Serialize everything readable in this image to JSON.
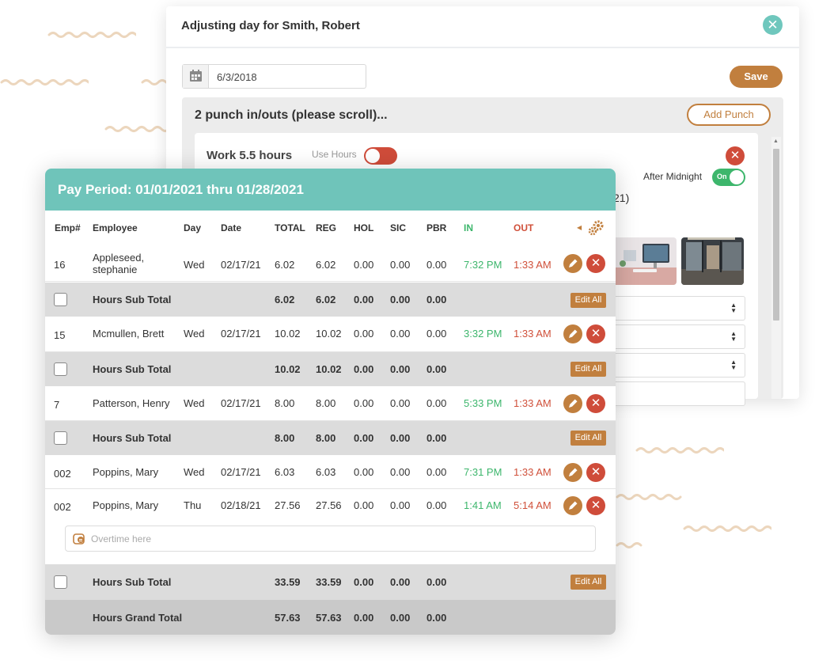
{
  "colors": {
    "teal": "#6fc4ba",
    "accent_brown": "#c17f3e",
    "delete_red": "#cf4c3a",
    "in_green": "#3db66c",
    "out_red": "#d0503a"
  },
  "modal": {
    "title": "Adjusting day for Smith, Robert",
    "close_icon": "close-icon",
    "date_value": "6/3/2018",
    "save_label": "Save",
    "punch_title": "2 punch in/outs (please scroll)...",
    "add_punch_label": "Add Punch",
    "work_label": "Work 5.5 hours",
    "use_hours_label": "Use Hours",
    "use_hours_enabled": false,
    "after_midnight_label": "After Midnight",
    "after_midnight_toggle": "On",
    "partial_text": "21)"
  },
  "payroll": {
    "title": "Pay Period: 01/01/2021 thru 01/28/2021",
    "columns": {
      "emp": "Emp#",
      "employee": "Employee",
      "day": "Day",
      "date": "Date",
      "total": "TOTAL",
      "reg": "REG",
      "hol": "HOL",
      "sic": "SIC",
      "pbr": "PBR",
      "in": "IN",
      "out": "OUT"
    },
    "rows": [
      {
        "emp": "16",
        "name": "Appleseed, stephanie",
        "day": "Wed",
        "date": "02/17/21",
        "total": "6.02",
        "reg": "6.02",
        "hol": "0.00",
        "sic": "0.00",
        "pbr": "0.00",
        "in": "7:32 PM",
        "out": "1:33 AM"
      },
      {
        "emp": "15",
        "name": "Mcmullen, Brett",
        "day": "Wed",
        "date": "02/17/21",
        "total": "10.02",
        "reg": "10.02",
        "hol": "0.00",
        "sic": "0.00",
        "pbr": "0.00",
        "in": "3:32 PM",
        "out": "1:33 AM"
      },
      {
        "emp": "7",
        "name": "Patterson, Henry",
        "day": "Wed",
        "date": "02/17/21",
        "total": "8.00",
        "reg": "8.00",
        "hol": "0.00",
        "sic": "0.00",
        "pbr": "0.00",
        "in": "5:33 PM",
        "out": "1:33 AM"
      },
      {
        "emp": "002",
        "name": "Poppins, Mary",
        "day": "Wed",
        "date": "02/17/21",
        "total": "6.03",
        "reg": "6.03",
        "hol": "0.00",
        "sic": "0.00",
        "pbr": "0.00",
        "in": "7:31 PM",
        "out": "1:33 AM"
      },
      {
        "emp": "002",
        "name": "Poppins, Mary",
        "day": "Thu",
        "date": "02/18/21",
        "total": "27.56",
        "reg": "27.56",
        "hol": "0.00",
        "sic": "0.00",
        "pbr": "0.00",
        "in": "1:41 AM",
        "out": "5:14 AM"
      }
    ],
    "subtotals": [
      {
        "label": "Hours Sub Total",
        "total": "6.02",
        "reg": "6.02",
        "hol": "0.00",
        "sic": "0.00",
        "pbr": "0.00",
        "edit_all": "Edit All"
      },
      {
        "label": "Hours Sub Total",
        "total": "10.02",
        "reg": "10.02",
        "hol": "0.00",
        "sic": "0.00",
        "pbr": "0.00",
        "edit_all": "Edit All"
      },
      {
        "label": "Hours Sub Total",
        "total": "8.00",
        "reg": "8.00",
        "hol": "0.00",
        "sic": "0.00",
        "pbr": "0.00",
        "edit_all": "Edit All"
      },
      {
        "label": "Hours Sub Total",
        "total": "33.59",
        "reg": "33.59",
        "hol": "0.00",
        "sic": "0.00",
        "pbr": "0.00",
        "edit_all": "Edit All"
      }
    ],
    "overtime_placeholder": "Overtime here",
    "grand_total": {
      "label": "Hours Grand Total",
      "total": "57.63",
      "reg": "57.63",
      "hol": "0.00",
      "sic": "0.00",
      "pbr": "0.00"
    }
  }
}
